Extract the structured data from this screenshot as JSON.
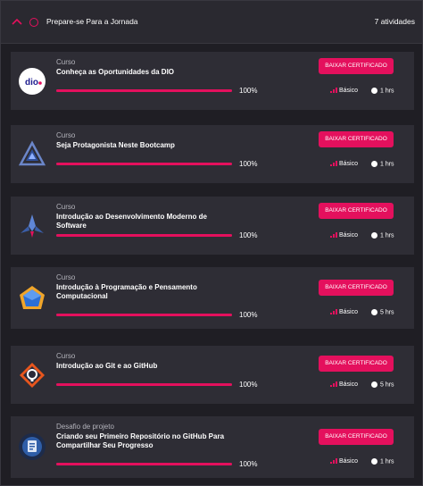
{
  "section": {
    "title": "Prepare-se Para a Jornada",
    "count": "7 atividades"
  },
  "colors": {
    "accent": "#e4105d",
    "card_bg": "#2e2d35",
    "page_bg": "#1f1e24"
  },
  "cards": [
    {
      "kind": "Curso",
      "title": "Conheça as Oportunidades da DIO",
      "progress": 100,
      "progress_label": "100%",
      "button": "BAIXAR CERTIFICADO",
      "level": "Básico",
      "hours": "1 hrs",
      "logo": "dio-logo-icon"
    },
    {
      "kind": "Curso",
      "title": "Seja Protagonista Neste Bootcamp",
      "progress": 100,
      "progress_label": "100%",
      "button": "BAIXAR CERTIFICADO",
      "level": "Básico",
      "hours": "1 hrs",
      "logo": "triangle-logo-icon"
    },
    {
      "kind": "Curso",
      "title": "Introdução ao Desenvolvimento Moderno de Software",
      "progress": 100,
      "progress_label": "100%",
      "button": "BAIXAR CERTIFICADO",
      "level": "Básico",
      "hours": "1 hrs",
      "logo": "spaceship-logo-icon"
    },
    {
      "kind": "Curso",
      "title": "Introdução à Programação e Pensamento Computacional",
      "progress": 100,
      "progress_label": "100%",
      "button": "BAIXAR CERTIFICADO",
      "level": "Básico",
      "hours": "5 hrs",
      "logo": "blue-cube-logo-icon"
    },
    {
      "kind": "Curso",
      "title": "Introdução ao Git e ao GitHub",
      "progress": 100,
      "progress_label": "100%",
      "button": "BAIXAR CERTIFICADO",
      "level": "Básico",
      "hours": "5 hrs",
      "logo": "github-logo-icon"
    },
    {
      "kind": "Desafio de projeto",
      "title": "Criando seu Primeiro Repositório no GitHub Para Compartilhar Seu Progresso",
      "progress": 100,
      "progress_label": "100%",
      "button": "BAIXAR CERTIFICADO",
      "level": "Básico",
      "hours": "1 hrs",
      "logo": "repository-logo-icon"
    }
  ]
}
